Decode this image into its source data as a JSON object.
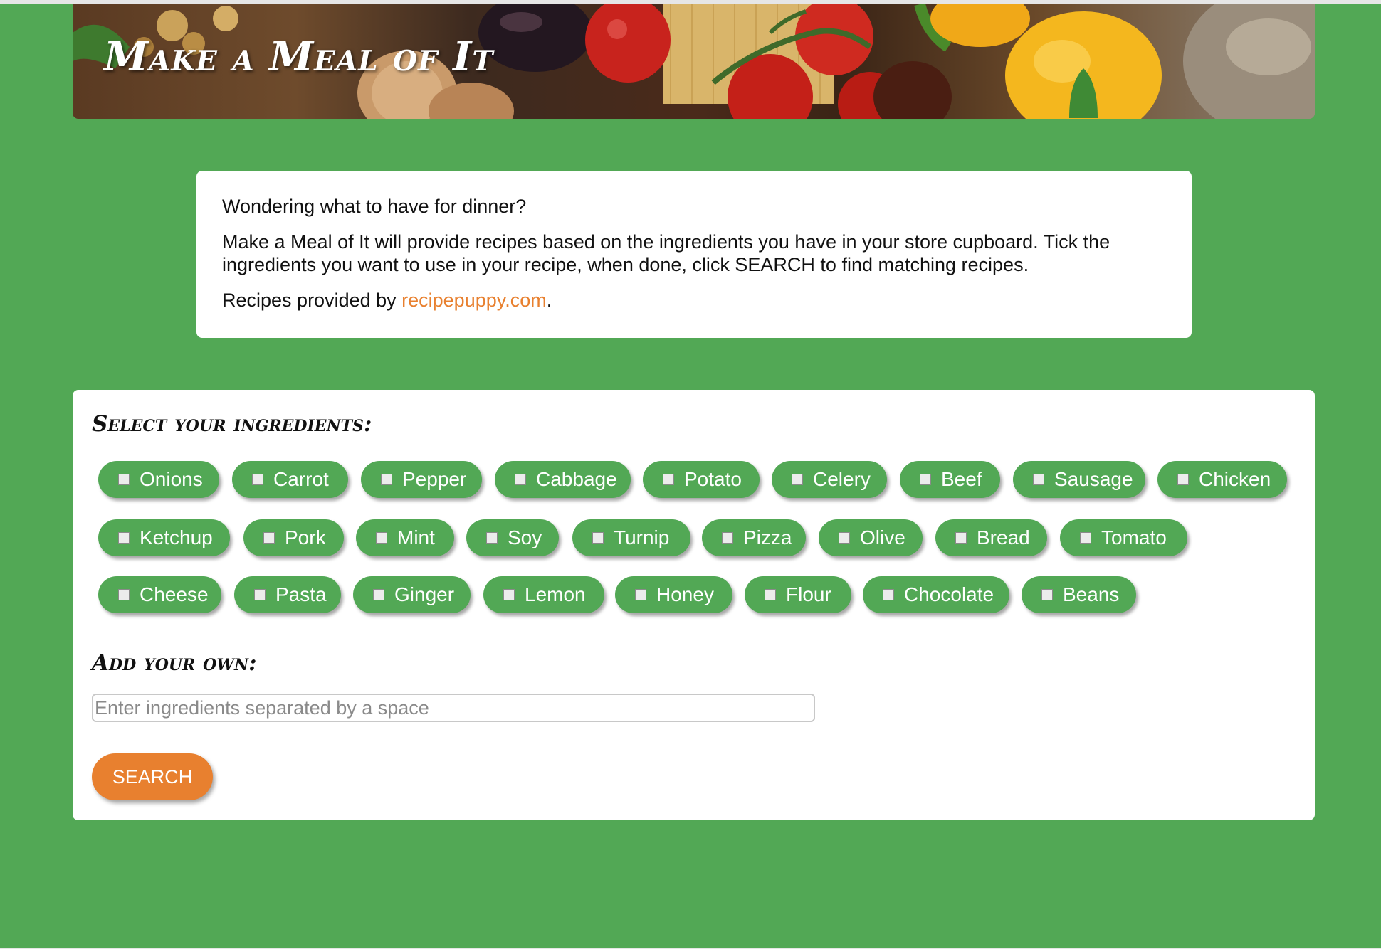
{
  "header": {
    "title": "Make a Meal of It"
  },
  "intro": {
    "question": "Wondering what to have for dinner?",
    "description": "Make a Meal of It will provide recipes based on the ingredients you have in your store cupboard. Tick the ingredients you want to use in your recipe, when done, click SEARCH to find matching recipes.",
    "credit_prefix": "Recipes provided by ",
    "credit_link": "recipepuppy.com",
    "credit_suffix": "."
  },
  "ingredients": {
    "title": "Select your ingredients:",
    "items": [
      "Onions",
      "Carrot",
      "Pepper",
      "Cabbage",
      "Potato",
      "Celery",
      "Beef",
      "Sausage",
      "Chicken",
      "Ketchup",
      "Pork",
      "Mint",
      "Soy",
      "Turnip",
      "Pizza",
      "Olive",
      "Bread",
      "Tomato",
      "Cheese",
      "Pasta",
      "Ginger",
      "Lemon",
      "Honey",
      "Flour",
      "Chocolate",
      "Beans"
    ]
  },
  "own": {
    "title": "Add your own:",
    "placeholder": "Enter ingredients separated by a space"
  },
  "search": {
    "label": "SEARCH"
  },
  "colors": {
    "background": "#52a855",
    "pill": "#52a855",
    "accent": "#e8802f"
  }
}
